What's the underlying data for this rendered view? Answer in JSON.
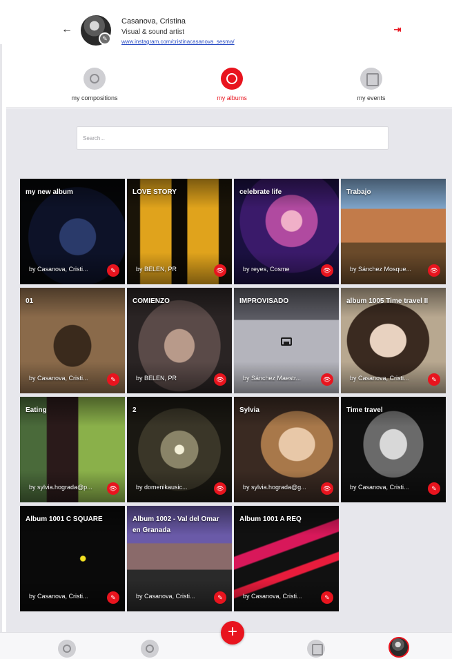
{
  "header": {
    "back_icon": "arrow-left-icon",
    "user_name": "Casanova, Cristina",
    "user_role": "Visual & sound artist",
    "user_link": "www.instagram.com/cristinacasanova_sesma/",
    "logout_icon": "logout-icon"
  },
  "tabs": [
    {
      "label": "my compositions",
      "icon": "compositions-icon",
      "active": false
    },
    {
      "label": "my albums",
      "icon": "albums-icon",
      "active": true
    },
    {
      "label": "my events",
      "icon": "calendar-icon",
      "active": false
    }
  ],
  "search": {
    "placeholder": "Search..."
  },
  "albums": [
    {
      "title": "my new album",
      "owner": "by Casanova, Cristi...",
      "action": "edit"
    },
    {
      "title": "LOVE STORY",
      "owner": "by BELEN, PR",
      "action": "view"
    },
    {
      "title": "celebrate life",
      "owner": "by reyes, Cosme",
      "action": "view"
    },
    {
      "title": "Trabajo",
      "owner": "by Sánchez Mosque...",
      "action": "view"
    },
    {
      "title": "01",
      "owner": "by Casanova, Cristi...",
      "action": "edit"
    },
    {
      "title": "COMIENZO",
      "owner": "by BELEN, PR",
      "action": "view"
    },
    {
      "title": "IMPROVISADO",
      "owner": "by Sánchez Maestr...",
      "action": "view"
    },
    {
      "title": "album 1005 Time travel II",
      "owner": "by Casanova, Cristi...",
      "action": "edit"
    },
    {
      "title": "Eating",
      "owner": "by sylvia.hograda@p...",
      "action": "view"
    },
    {
      "title": "2",
      "owner": "by domenikausic...",
      "action": "view"
    },
    {
      "title": "Sylvia",
      "owner": "by sylvia.hograda@g...",
      "action": "view"
    },
    {
      "title": "Time travel",
      "owner": "by Casanova, Cristi...",
      "action": "edit"
    },
    {
      "title": "Album 1001 C SQUARE",
      "owner": "by Casanova, Cristi...",
      "action": "edit"
    },
    {
      "title": "Album 1002 - Val del Omar en Granada",
      "owner": "by Casanova, Cristi...",
      "action": "edit"
    },
    {
      "title": "Album 1001 A REQ",
      "owner": "by Casanova, Cristi...",
      "action": "edit"
    }
  ],
  "bottom_nav": [
    {
      "icon": "compositions-icon"
    },
    {
      "icon": "albums-icon"
    },
    {
      "icon": "add-icon",
      "label": "+"
    },
    {
      "icon": "calendar-icon"
    },
    {
      "icon": "profile-avatar"
    }
  ],
  "colors": {
    "accent": "#e8141e",
    "background": "#e7e7ec",
    "link": "#2a4dc4"
  }
}
